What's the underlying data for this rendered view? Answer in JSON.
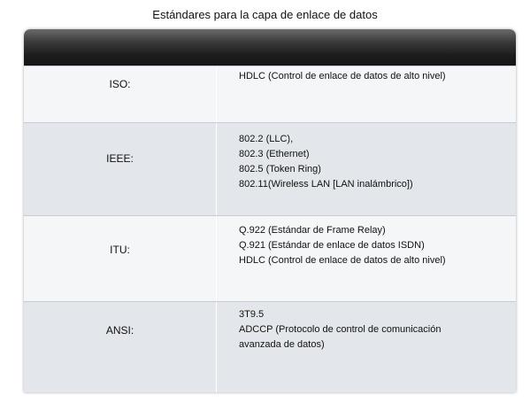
{
  "title": "Estándares para la capa de enlace de datos",
  "rows": [
    {
      "org": "ISO:",
      "standards": [
        "HDLC (Control de enlace de datos de alto nivel)"
      ]
    },
    {
      "org": "IEEE:",
      "standards": [
        "802.2 (LLC),",
        "802.3 (Ethernet)",
        "802.5 (Token Ring)",
        "802.11(Wireless LAN [LAN inalámbrico])"
      ]
    },
    {
      "org": "ITU:",
      "standards": [
        "Q.922 (Estándar de Frame Relay)",
        "Q.921 (Estándar de enlace de datos ISDN)",
        "HDLC (Control de enlace de datos de alto nivel)"
      ]
    },
    {
      "org": "ANSI:",
      "standards": [
        "3T9.5",
        "ADCCP (Protocolo de control de comunicación",
        "avanzada de datos)"
      ]
    }
  ]
}
